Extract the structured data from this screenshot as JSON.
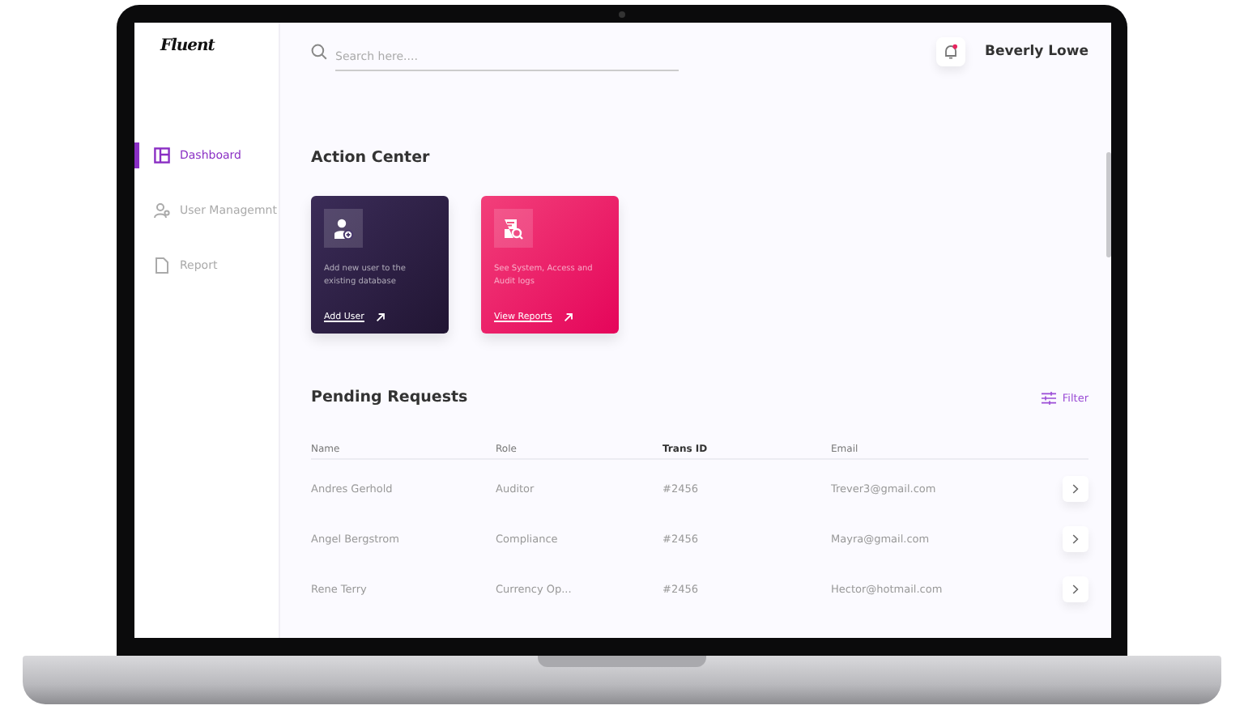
{
  "app": {
    "logo": "Fluent"
  },
  "sidebar": {
    "items": [
      {
        "label": "Dashboard",
        "kind": "dashboard",
        "selected": true
      },
      {
        "label": "User Managemnt",
        "kind": "users",
        "selected": false
      },
      {
        "label": "Report",
        "kind": "report",
        "selected": false
      }
    ]
  },
  "topbar": {
    "search": {
      "placeholder": "Search here...."
    },
    "notifications": {
      "unread": true
    },
    "user_name": "Beverly Lowe"
  },
  "action_center": {
    "title": "Action Center",
    "cards": [
      {
        "kind": "dark",
        "description": "Add new user to the existing database",
        "link": "Add User"
      },
      {
        "kind": "pink",
        "description": "See System, Access and Audit logs",
        "link": "View Reports"
      }
    ]
  },
  "pending_requests": {
    "title": "Pending Requests",
    "filter": "Filter",
    "columns": [
      {
        "label": "Name",
        "sorted": false
      },
      {
        "label": "Role",
        "sorted": false
      },
      {
        "label": "Trans ID",
        "sorted": true
      },
      {
        "label": "Email",
        "sorted": false
      }
    ],
    "rows": [
      {
        "name": "Andres Gerhold",
        "role": "Auditor",
        "trans_id": "#2456",
        "email": "Trever3@gmail.com"
      },
      {
        "name": "Angel Bergstrom",
        "role": "Compliance",
        "trans_id": "#2456",
        "email": "Mayra@gmail.com"
      },
      {
        "name": "Rene Terry",
        "role": "Currency Op...",
        "trans_id": "#2456",
        "email": "Hector@hotmail.com"
      }
    ]
  }
}
